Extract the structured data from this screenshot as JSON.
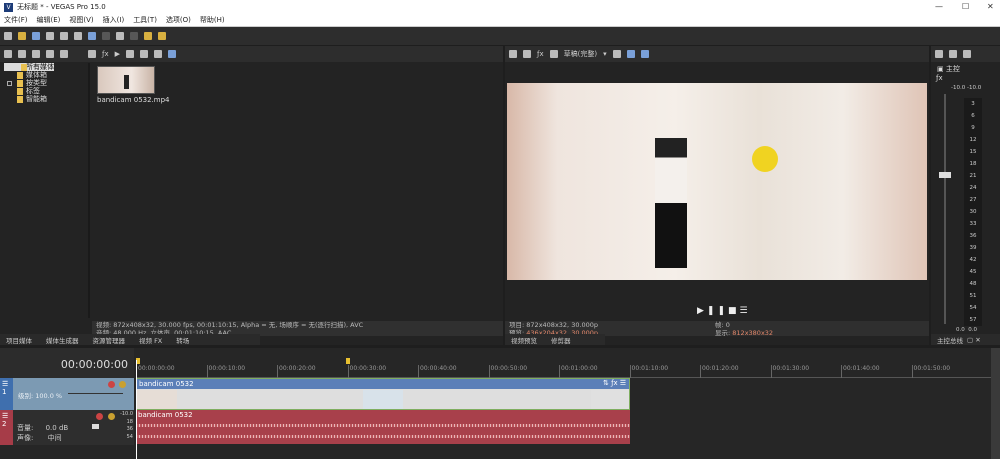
{
  "window": {
    "title": "无标题 * - VEGAS Pro 15.0",
    "logo": "V"
  },
  "menu": [
    "文件(F)",
    "编辑(E)",
    "视图(V)",
    "插入(I)",
    "工具(T)",
    "选项(O)",
    "帮助(H)"
  ],
  "media": {
    "tree": [
      "所有媒体",
      "媒体箱",
      "按类型",
      "标签",
      "智能箱"
    ],
    "file": "bandicam 0532.mp4",
    "info_video": "视频: 872x408x32, 30.000 fps, 00:01:10:15, Alpha = 无, 场顺序 = 无(逐行扫描), AVC",
    "info_audio": "音频: 48,000 Hz, 立体声, 00:01:10:15, AAC",
    "tabs": [
      "项目媒体",
      "媒体生成器",
      "资源管理器",
      "视频 FX",
      "转场"
    ]
  },
  "preview": {
    "quality": "草稿(完整)",
    "project_label": "项目:",
    "project": "872x408x32, 30.000p",
    "preview_label": "预览:",
    "preview": "436x204x32, 30.000p",
    "frame_label": "帧:",
    "frame": "0",
    "display_label": "显示:",
    "display": "812x380x32",
    "tabs": [
      "视频预览",
      "修剪器"
    ]
  },
  "mixer": {
    "label": "主控",
    "left": "-10.0",
    "right": "-10.0",
    "scale": [
      "3",
      "6",
      "9",
      "12",
      "15",
      "18",
      "21",
      "24",
      "27",
      "30",
      "33",
      "36",
      "39",
      "42",
      "45",
      "48",
      "51",
      "54",
      "57"
    ],
    "bottom_l": "0.0",
    "bottom_r": "0.0",
    "tab": "主控总线"
  },
  "timeline": {
    "time": "00:00:00:00",
    "ticks": [
      "00:00:00:00",
      "00:00:10:00",
      "00:00:20:00",
      "00:00:30:00",
      "00:00:40:00",
      "00:00:50:00",
      "00:01:00:00",
      "00:01:10:00",
      "00:01:20:00",
      "00:01:30:00",
      "00:01:40:00",
      "00:01:50:00"
    ],
    "video_track": {
      "num": "1",
      "level": "级别: 100.0 %",
      "clip": "bandicam 0532"
    },
    "audio_track": {
      "num": "2",
      "volume_label": "音量:",
      "volume": "0.0 dB",
      "pan_label": "声像:",
      "pan": "中间",
      "clip": "bandicam 0532",
      "meter": [
        "-10.0",
        "18",
        "36",
        "54"
      ]
    }
  }
}
